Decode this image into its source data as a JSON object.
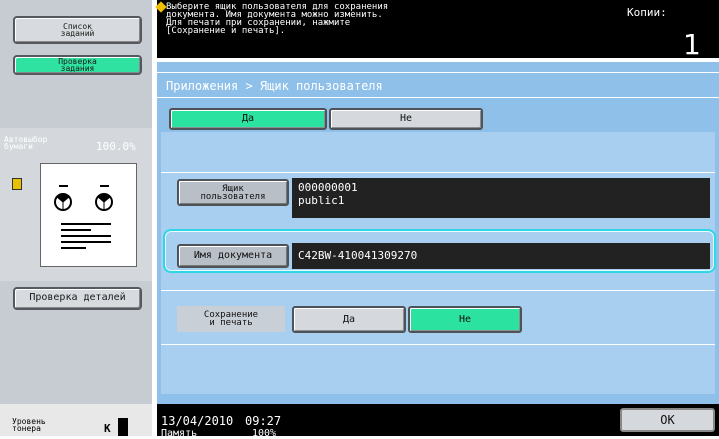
{
  "left_panel": {
    "job_list_label": "Список\nзаданий",
    "job_check_label": "Проверка\nзадания",
    "paper_auto_label": "Автовыбор\nбумаги",
    "paper_zoom": "100.0%",
    "check_details_label": "Проверка деталей",
    "toner_label": "Уровень\nтонера",
    "toner_color": "K"
  },
  "message": {
    "text": "Выберите ящик пользователя для сохранения\nдокумента. Имя документа можно изменить.\nДля печати при сохранении, нажмите\n[Сохранение и печать].",
    "copies_label": "Копии:",
    "copies_value": "1"
  },
  "breadcrumb": "Приложения > Ящик пользователя",
  "toggle": {
    "yes": "Да",
    "no": "Не",
    "selected": "yes"
  },
  "user_box": {
    "label": "Ящик\nпользователя",
    "value_line1": "000000001",
    "value_line2": "public1"
  },
  "doc_name": {
    "label": "Имя документа",
    "value": "C42BW-410041309270"
  },
  "save_print": {
    "label": "Сохранение\nи печать",
    "yes": "Да",
    "no": "Не",
    "selected": "no"
  },
  "status": {
    "date": "13/04/2010",
    "time": "09:27",
    "memory_label": "Память",
    "memory_value": "100%"
  },
  "ok_label": "OK",
  "colors": {
    "accent_green": "#2ce2a0",
    "panel_blue": "#8ec0ea",
    "highlight": "#2fd6e6"
  }
}
